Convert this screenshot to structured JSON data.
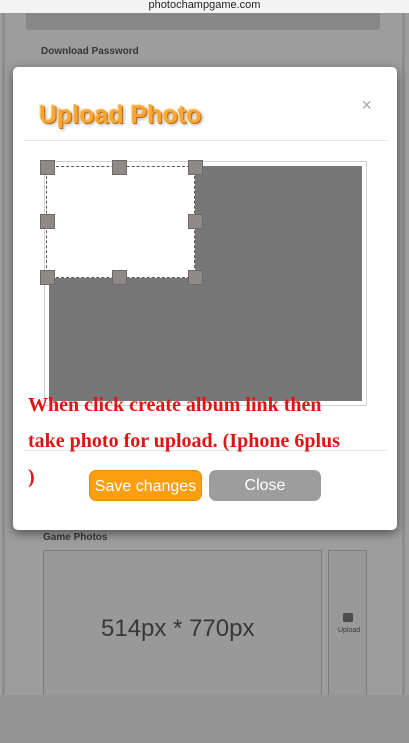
{
  "browser": {
    "url": "photochampgame.com"
  },
  "background": {
    "download_password_label": "Download Password",
    "game_photos_label": "Game Photos",
    "dimensions_text": "514px * 770px",
    "upload_label": "Upload"
  },
  "modal": {
    "title": "Upload Photo",
    "close_glyph": "×",
    "note": "When click  create album link then take photo for upload.  (Iphone 6plus )",
    "save_label": "Save changes",
    "close_label": "Close"
  },
  "colors": {
    "title": "#f7a637",
    "note": "#e01414",
    "save_button": "#fb9e10",
    "close_button": "#9d9d9d",
    "crop_image": "#777777"
  }
}
